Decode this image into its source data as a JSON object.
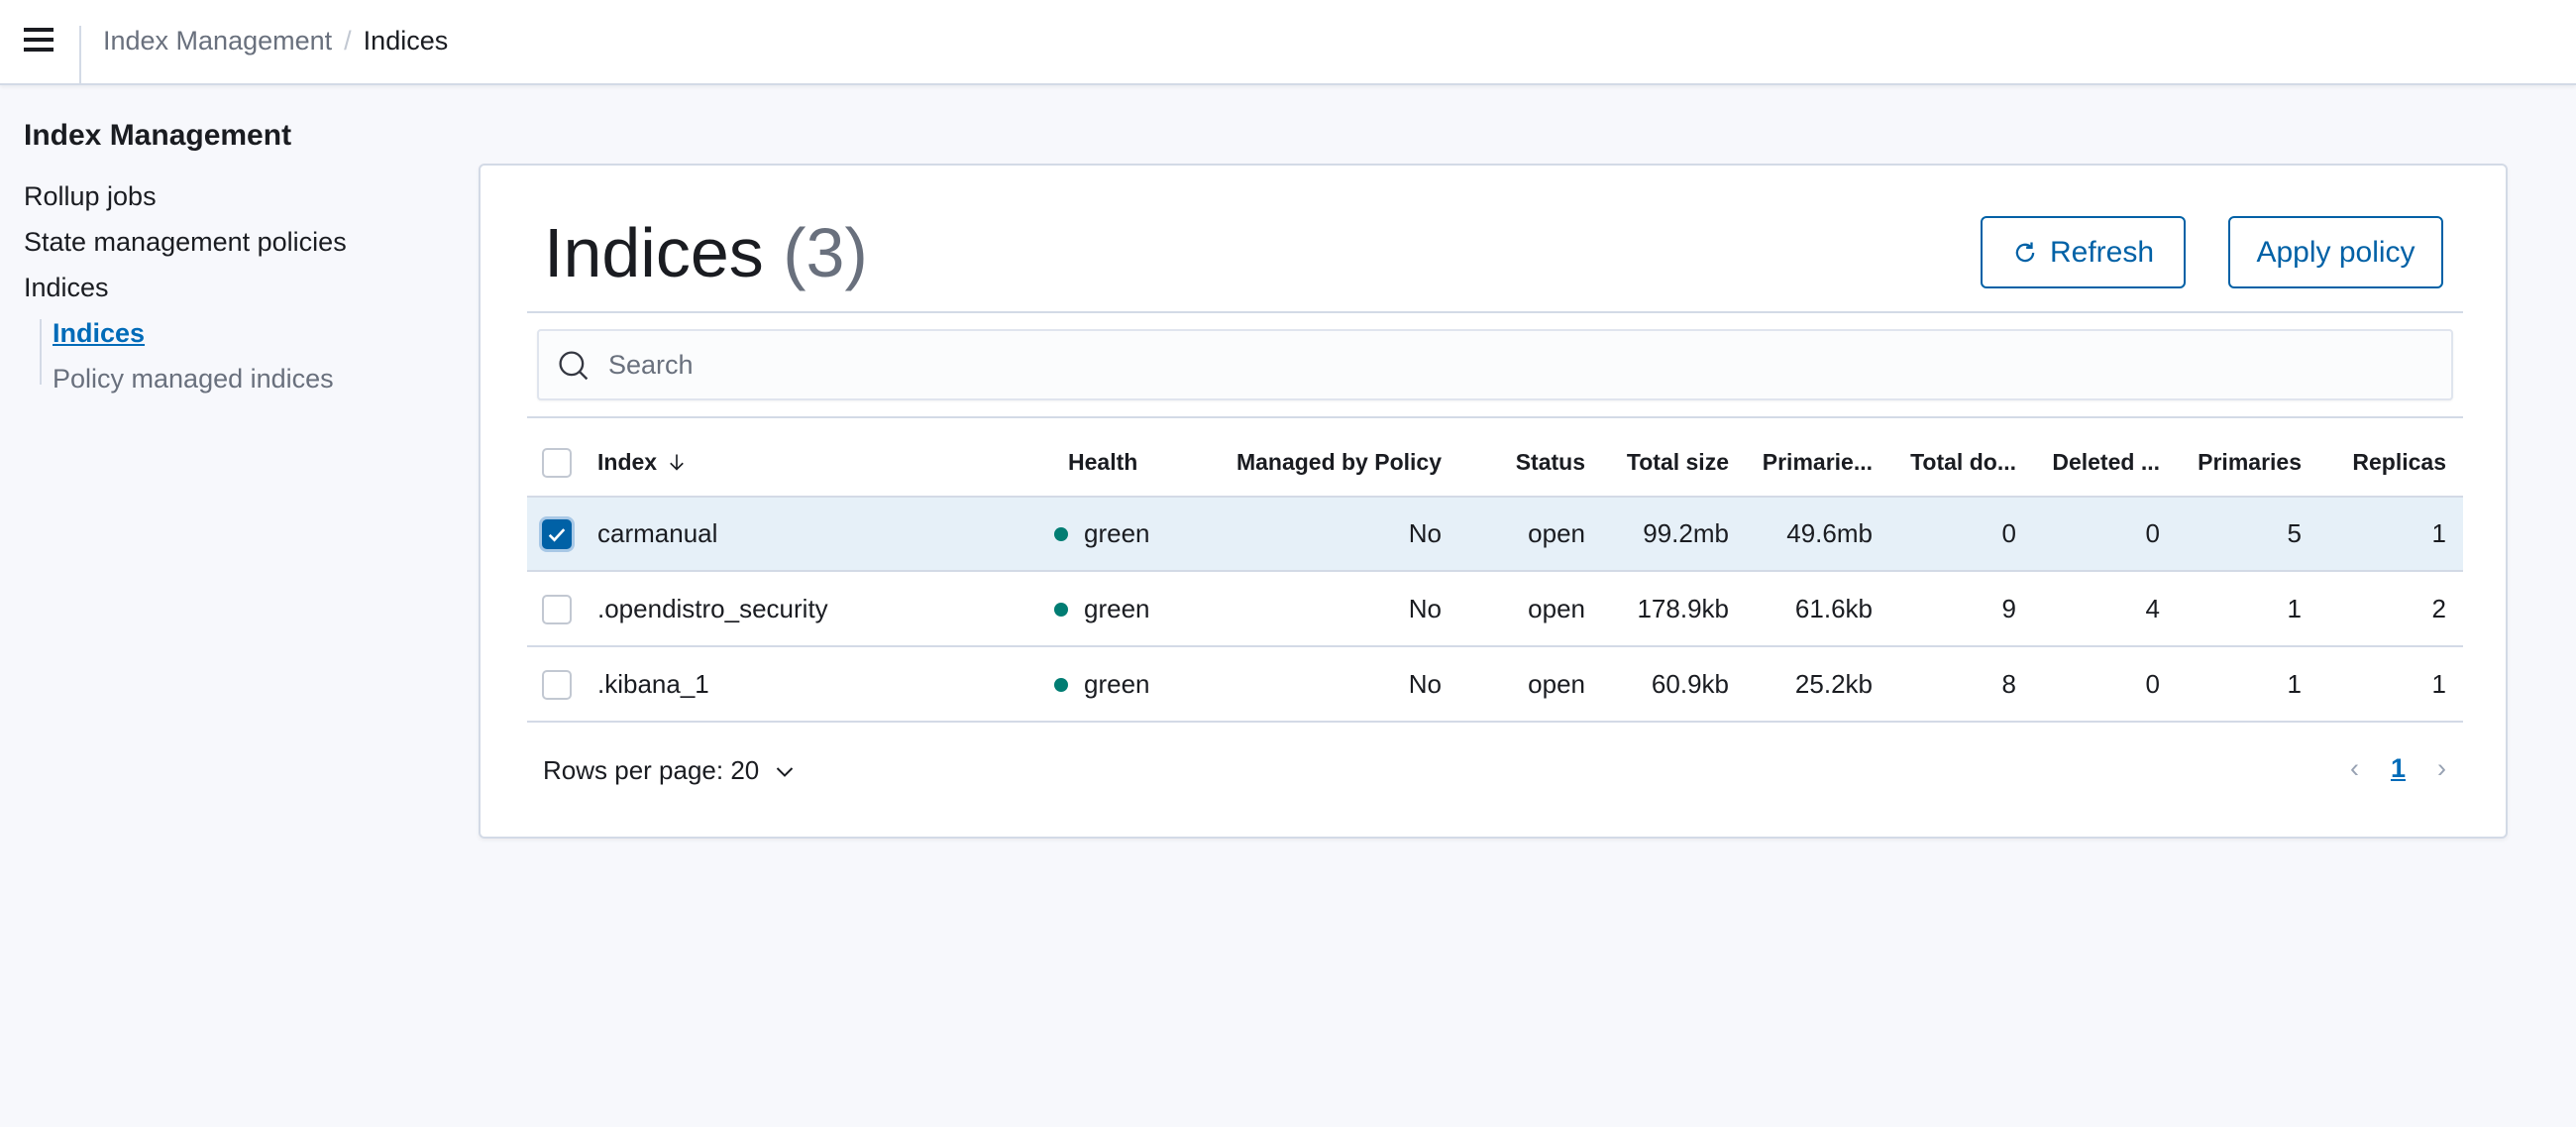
{
  "header": {
    "breadcrumbs": [
      "Index Management",
      "Indices"
    ]
  },
  "sidebar": {
    "title": "Index Management",
    "items": [
      {
        "label": "Rollup jobs"
      },
      {
        "label": "State management policies"
      },
      {
        "label": "Indices"
      }
    ],
    "sub_items": [
      {
        "label": "Indices",
        "active": true
      },
      {
        "label": "Policy managed indices"
      }
    ]
  },
  "main": {
    "title": "Indices",
    "count": "(3)",
    "refresh_label": "Refresh",
    "apply_policy_label": "Apply policy",
    "search_placeholder": "Search",
    "columns": [
      "Index",
      "Health",
      "Managed by Policy",
      "Status",
      "Total size",
      "Primarie...",
      "Total do...",
      "Deleted ...",
      "Primaries",
      "Replicas"
    ],
    "sort_indicator": "arrow-down-icon",
    "rows": [
      {
        "selected": true,
        "cells": [
          "carmanual",
          "green",
          "No",
          "open",
          "99.2mb",
          "49.6mb",
          "0",
          "0",
          "5",
          "1"
        ]
      },
      {
        "selected": false,
        "cells": [
          ".opendistro_security",
          "green",
          "No",
          "open",
          "178.9kb",
          "61.6kb",
          "9",
          "4",
          "1",
          "2"
        ]
      },
      {
        "selected": false,
        "cells": [
          ".kibana_1",
          "green",
          "No",
          "open",
          "60.9kb",
          "25.2kb",
          "8",
          "0",
          "1",
          "1"
        ]
      }
    ],
    "rows_per_page": "Rows per page: 20",
    "current_page": "1"
  },
  "colors": {
    "accent": "#0061a6",
    "health_green": "#017d73",
    "selected_row": "#e6f0f8"
  }
}
